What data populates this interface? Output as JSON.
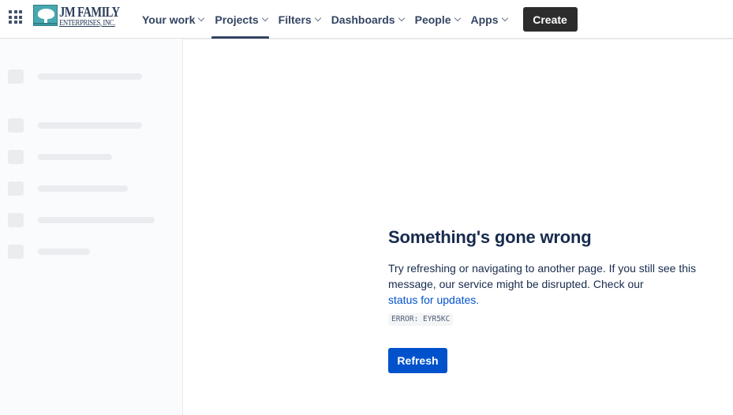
{
  "header": {
    "logo": {
      "line1": "JM FAMILY",
      "line2": "ENTERPRISES, INC."
    },
    "nav": [
      {
        "label": "Your work",
        "active": false
      },
      {
        "label": "Projects",
        "active": true
      },
      {
        "label": "Filters",
        "active": false
      },
      {
        "label": "Dashboards",
        "active": false
      },
      {
        "label": "People",
        "active": false
      },
      {
        "label": "Apps",
        "active": false
      }
    ],
    "create_label": "Create"
  },
  "error": {
    "title": "Something's gone wrong",
    "description": "Try refreshing or navigating to another page. If you still see this message, our service might be disrupted. Check our",
    "link_text": "status for updates.",
    "code": "ERROR: EYR5KC",
    "refresh_label": "Refresh"
  },
  "colors": {
    "primary": "#0052cc",
    "create_button": "#2c2c2c",
    "text": "#172b4d",
    "skeleton": "#ebecf0"
  },
  "icons": {
    "app_switcher": "grid-icon",
    "dropdown": "chevron-down-icon"
  }
}
